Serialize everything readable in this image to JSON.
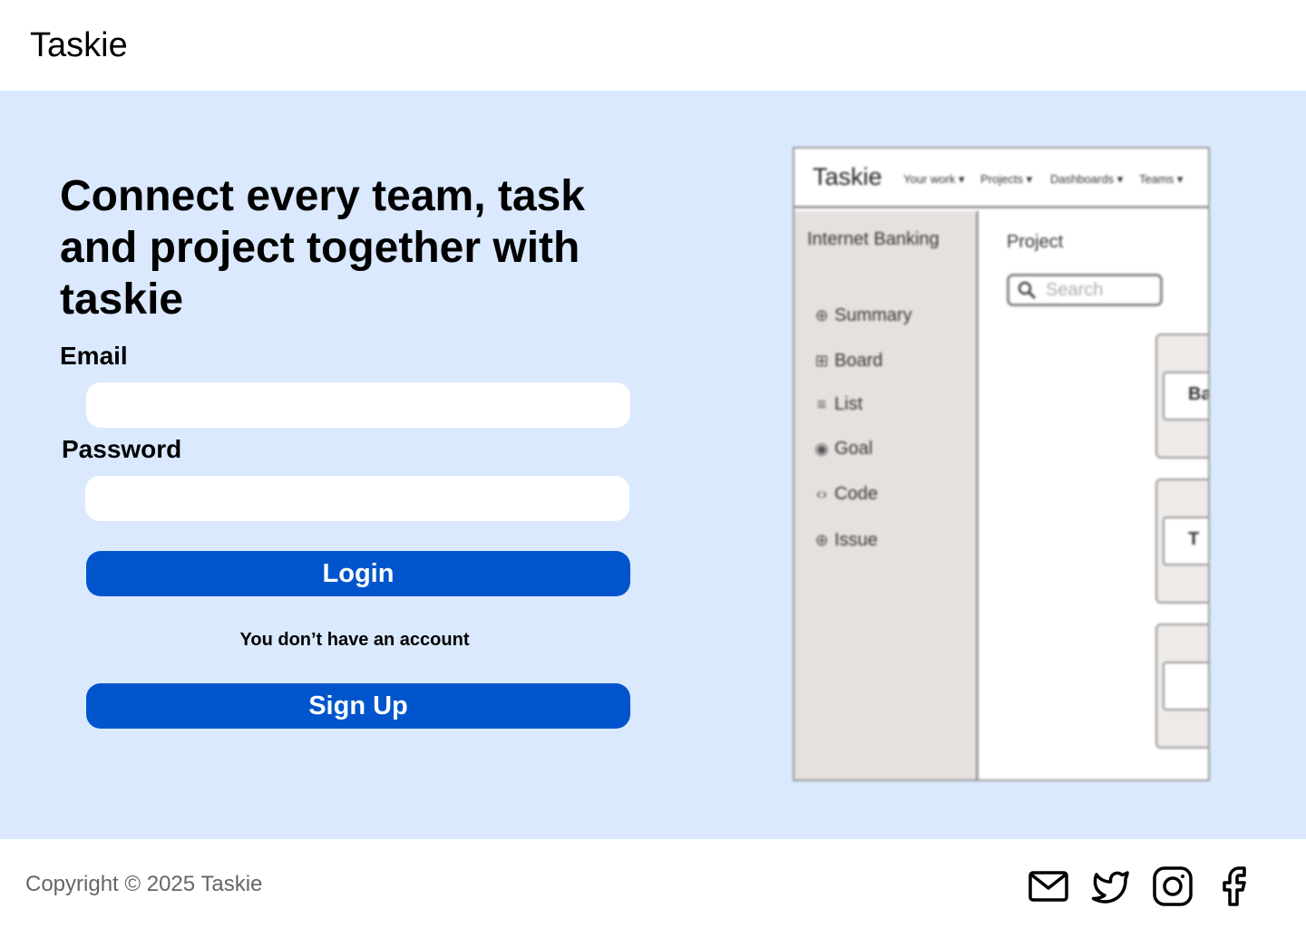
{
  "header": {
    "brand": "Taskie"
  },
  "hero": {
    "headline": "Connect every team, task and project together with taskie",
    "email_label": "Email",
    "email_value": "",
    "password_label": "Password",
    "password_value": "",
    "login_label": "Login",
    "no_account_text": "You don’t have an account",
    "signup_label": "Sign Up",
    "accent_color": "#0055cc",
    "background_color": "#dae9fd"
  },
  "preview": {
    "brand": "Taskie",
    "nav": [
      "Your work",
      "Projects",
      "Dashboards",
      "Teams"
    ],
    "sidebar_title": "Internet Banking",
    "sidebar_items": [
      {
        "label": "Summary",
        "icon": "globe-icon"
      },
      {
        "label": "Board",
        "icon": "grid-icon"
      },
      {
        "label": "List",
        "icon": "list-icon"
      },
      {
        "label": "Goal",
        "icon": "target-icon"
      },
      {
        "label": "Code",
        "icon": "code-icon"
      },
      {
        "label": "Issue",
        "icon": "plus-circle-icon"
      }
    ],
    "main_title": "Project",
    "search_placeholder": "Search",
    "card_labels": [
      "Ba",
      "T",
      ""
    ]
  },
  "footer": {
    "copyright": "Copyright © 2025 Taskie",
    "social_icons": [
      "mail-icon",
      "twitter-icon",
      "instagram-icon",
      "facebook-icon"
    ]
  }
}
